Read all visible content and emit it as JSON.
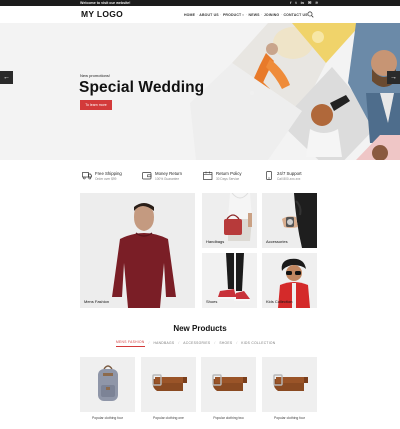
{
  "topbar": {
    "welcome": "Welcome to visit our website!",
    "social": [
      "f",
      "t",
      "in",
      "✉",
      "℗"
    ]
  },
  "header": {
    "logo": "MY LOGO",
    "nav": [
      "HOME",
      "ABOUT US",
      "PRODUCT",
      "NEWS",
      "JOINING",
      "CONTACT US"
    ]
  },
  "hero": {
    "kicker": "New promotions!",
    "title": "Special Wedding",
    "button": "To learn more",
    "prev_icon": "arrow-left-icon",
    "next_icon": "arrow-right-icon"
  },
  "features": [
    {
      "title": "Free Shipping",
      "sub": "Order over $99",
      "icon": "truck-icon"
    },
    {
      "title": "Money Return",
      "sub": "100% Guarantee",
      "icon": "wallet-icon"
    },
    {
      "title": "Return Policy",
      "sub": "30 Days Service",
      "icon": "calendar-icon"
    },
    {
      "title": "24/7 Support",
      "sub": "Call 800-xxx-xxx",
      "icon": "phone-icon"
    }
  ],
  "categories": {
    "mens": "Mens Fashion",
    "handbags": "Handbags",
    "accessories": "Accessories",
    "shoes": "Shoes",
    "kids": "Kids Collection"
  },
  "new_products": {
    "title": "New Products",
    "tabs": [
      "MENS FASHION",
      "HANDBAGS",
      "ACCESSORIES",
      "SHOES",
      "KIDS COLLECTION"
    ],
    "active_tab": "MENS FASHION",
    "items": [
      {
        "name": "Popular clothing four"
      },
      {
        "name": "Popular clothing one"
      },
      {
        "name": "Popular clothing two"
      },
      {
        "name": "Popular clothing four"
      }
    ]
  },
  "colors": {
    "accent": "#d33a3a",
    "topbar": "#1c1c1c",
    "hero_bg": "#f3f3f3",
    "tile_bg": "#ececec"
  }
}
